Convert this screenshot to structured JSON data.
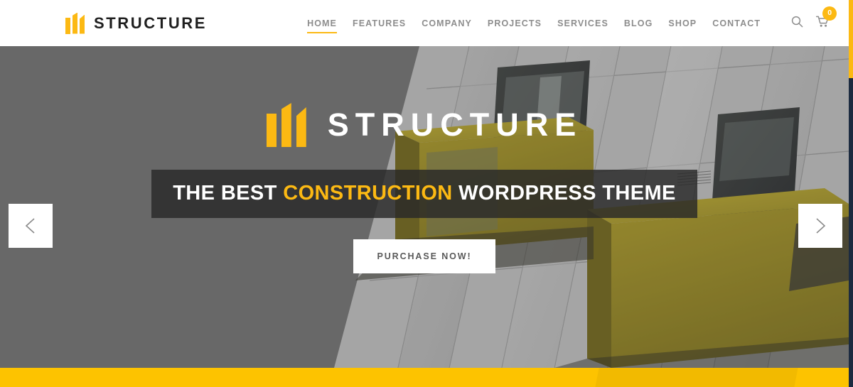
{
  "site": {
    "brand_name": "STRUCTURE",
    "accent_color": "#fcb913",
    "band_color": "#fdc300",
    "nav_text_color": "#8d8d8d"
  },
  "header": {
    "logo_label": "STRUCTURE",
    "logo_icon": "structure-bars-logo",
    "nav": [
      {
        "label": "HOME",
        "active": true
      },
      {
        "label": "FEATURES",
        "active": false
      },
      {
        "label": "COMPANY",
        "active": false
      },
      {
        "label": "PROJECTS",
        "active": false
      },
      {
        "label": "SERVICES",
        "active": false
      },
      {
        "label": "BLOG",
        "active": false
      },
      {
        "label": "SHOP",
        "active": false
      },
      {
        "label": "CONTACT",
        "active": false
      }
    ],
    "icons": {
      "search": "search-icon",
      "cart": "shopping-cart-icon",
      "cart_count": "0"
    }
  },
  "hero": {
    "logo_label": "STRUCTURE",
    "logo_icon": "structure-bars-logo",
    "headline_pre": "THE BEST ",
    "headline_accent": "CONSTRUCTION",
    "headline_post": " WORDPRESS THEME",
    "cta_label": "PURCHASE NOW!",
    "prev_icon": "chevron-left-icon",
    "next_icon": "chevron-right-icon",
    "background": "modern-building-facade-photo"
  },
  "scrollbar": {
    "thumb_color": "#fcb913",
    "track_color": "#1c2b40"
  }
}
